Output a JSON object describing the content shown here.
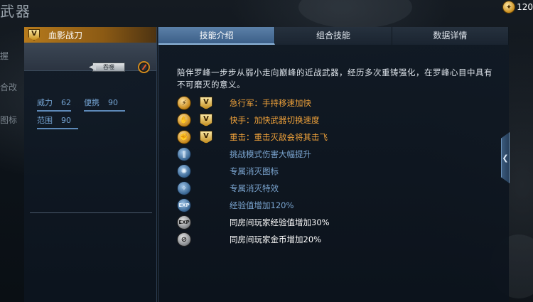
{
  "screen": {
    "title": "武器"
  },
  "background_menu": [
    "握",
    "合改",
    "图标"
  ],
  "currency": {
    "value": "120",
    "icon": "coin-icon"
  },
  "weapon": {
    "badge": "V",
    "name": "血影战刀",
    "equip_tag": "吞噬",
    "stats": [
      {
        "label": "威力",
        "value": "62"
      },
      {
        "label": "便携",
        "value": "90"
      },
      {
        "label": "范围",
        "value": "90"
      }
    ]
  },
  "tabs": [
    {
      "label": "技能介绍",
      "active": true
    },
    {
      "label": "组合技能",
      "active": false
    },
    {
      "label": "数据详情",
      "active": false
    }
  ],
  "description": "陪伴罗峰一步步从弱小走向巅峰的近战武器，经历多次重铸强化，在罗峰心目中具有不可磨灭的意义。",
  "skills": [
    {
      "text": "急行军：手持移速加快",
      "color": "orange",
      "icon": "runner-icon",
      "icon_style": "gold",
      "v_badge": true
    },
    {
      "text": "快手：加快武器切换速度",
      "color": "orange",
      "icon": "fast-hand-icon",
      "icon_style": "gold",
      "v_badge": true
    },
    {
      "text": "重击：重击灭敌会将其击飞",
      "color": "orange",
      "icon": "heavy-strike-icon",
      "icon_style": "gold",
      "v_badge": true
    },
    {
      "text": "挑战模式伤害大幅提升",
      "color": "blue",
      "icon": "claw-damage-icon",
      "icon_style": "blue",
      "v_badge": false
    },
    {
      "text": "专属消灭图标",
      "color": "blue",
      "icon": "kill-mark-icon",
      "icon_style": "blue",
      "v_badge": false
    },
    {
      "text": "专属消灭特效",
      "color": "blue",
      "icon": "kill-effect-icon",
      "icon_style": "blue",
      "v_badge": false
    },
    {
      "text": "经验值增加120%",
      "color": "blue",
      "icon": "exp-icon",
      "icon_style": "blue",
      "v_badge": false
    },
    {
      "text": "同房间玩家经验值增加30%",
      "color": "white",
      "icon": "room-exp-icon",
      "icon_style": "grey",
      "v_badge": false
    },
    {
      "text": "同房间玩家金币增加20%",
      "color": "white",
      "icon": "room-coin-icon",
      "icon_style": "grey",
      "v_badge": false
    }
  ],
  "colors": {
    "accent_gold": "#f0a23a",
    "accent_blue": "#7aa4cf",
    "tab_active": "#4d729b",
    "header_gold": "#b67a1c"
  }
}
